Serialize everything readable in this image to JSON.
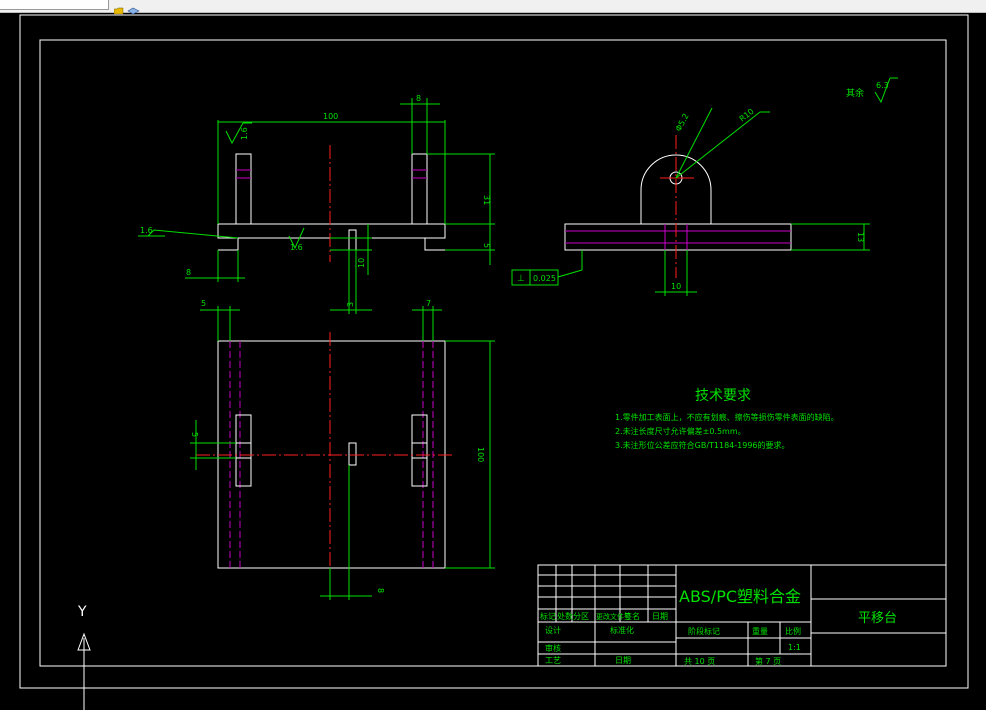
{
  "drawing": {
    "top_view": {
      "dim_width": "100",
      "dim_upright": "8",
      "dim_height": "31",
      "dim_base": "5",
      "dim_left_offset": "8",
      "dim_slot": "10",
      "dim_slot_width": "3",
      "roughness_a": "1.6",
      "roughness_b": "1.6",
      "roughness_c": "1.6"
    },
    "side_view": {
      "dim_hole": "Φ5.2",
      "dim_radius": "R10",
      "dim_thickness": "13",
      "dim_boss": "10",
      "tolerance": "0.025",
      "other_roughness_label": "其余",
      "other_roughness_value": "6.3"
    },
    "plan_view": {
      "dim_left": "5",
      "dim_right": "7",
      "dim_depth": "100",
      "dim_slot": "5",
      "dim_bottom": "8"
    },
    "tech_req": {
      "title": "技术要求",
      "items": [
        "1.零件加工表面上，不应有划痕、擦伤等损伤零件表面的缺陷。",
        "2.未注长度尺寸允许偏差±0.5mm。",
        "3.未注形位公差应符合GB/T1184-1996的要求。"
      ]
    },
    "title_block": {
      "material": "ABS/PC塑料合金",
      "part_name": "平移台",
      "col_mark": "标记",
      "col_count": "处数",
      "col_zone": "分区",
      "col_doc": "更改文件号",
      "col_sign": "签名",
      "col_date": "日期",
      "designer": "设计",
      "standardize": "标准化",
      "review": "审核",
      "process": "工艺",
      "approve_date": "日期",
      "stage_mark": "阶段标记",
      "weight": "重量",
      "scale_label": "比例",
      "scale_value": "1:1",
      "total_sheets": "共 10 页",
      "sheet_no": "第 7 页"
    },
    "ucs": {
      "y_label": "Y"
    }
  }
}
